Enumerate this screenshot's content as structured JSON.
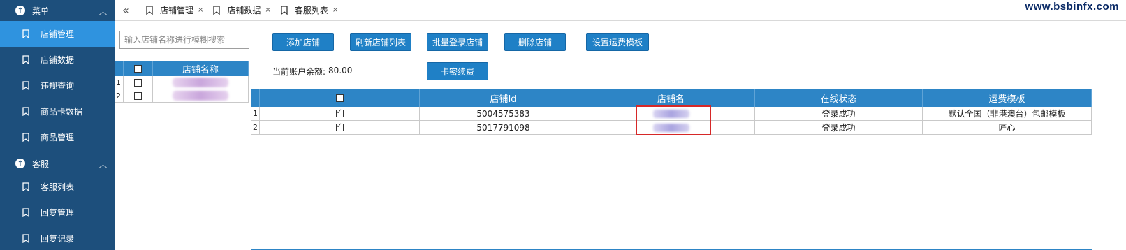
{
  "watermark": "www.bsbinfx.com",
  "sidebar": {
    "groups": [
      {
        "label": "菜单",
        "items": [
          {
            "label": "店铺管理"
          },
          {
            "label": "店铺数据"
          },
          {
            "label": "违规查询"
          },
          {
            "label": "商品卡数据"
          },
          {
            "label": "商品管理"
          }
        ]
      },
      {
        "label": "客服",
        "items": [
          {
            "label": "客服列表"
          },
          {
            "label": "回复管理"
          },
          {
            "label": "回复记录"
          }
        ]
      }
    ],
    "active": "店铺管理"
  },
  "tabs": {
    "collapse_glyph": "«",
    "items": [
      {
        "label": "店铺管理"
      },
      {
        "label": "店铺数据"
      },
      {
        "label": "客服列表"
      }
    ],
    "close_glyph": "×"
  },
  "store_panel": {
    "search_placeholder": "输入店铺名称进行模糊搜索",
    "header_name": "店铺名称",
    "rows": [
      {
        "index": "1"
      },
      {
        "index": "2"
      }
    ]
  },
  "toolbar": {
    "add_store": "添加店铺",
    "refresh_list": "刷新店铺列表",
    "batch_login": "批量登录店铺",
    "delete_store": "删除店铺",
    "set_shipping_template": "设置运费模板",
    "card_renew": "卡密续费"
  },
  "balance": {
    "label": "当前账户余额:",
    "value": "80.00"
  },
  "grid": {
    "columns": {
      "store_id": "店铺Id",
      "store_name": "店铺名",
      "online_status": "在线状态",
      "shipping_template": "运费模板"
    },
    "rows": [
      {
        "index": "1",
        "store_id": "5004575383",
        "online_status": "登录成功",
        "shipping_template": "默认全国（非港澳台）包邮模板",
        "checked": true
      },
      {
        "index": "2",
        "store_id": "5017791098",
        "online_status": "登录成功",
        "shipping_template": "匠心",
        "checked": true
      }
    ]
  },
  "colors": {
    "sidebar_bg": "#1d4f7c",
    "active_item": "#2f93df",
    "header_blue": "#2d85c6",
    "button_blue": "#1f80c6",
    "highlight_red": "#d62828"
  }
}
